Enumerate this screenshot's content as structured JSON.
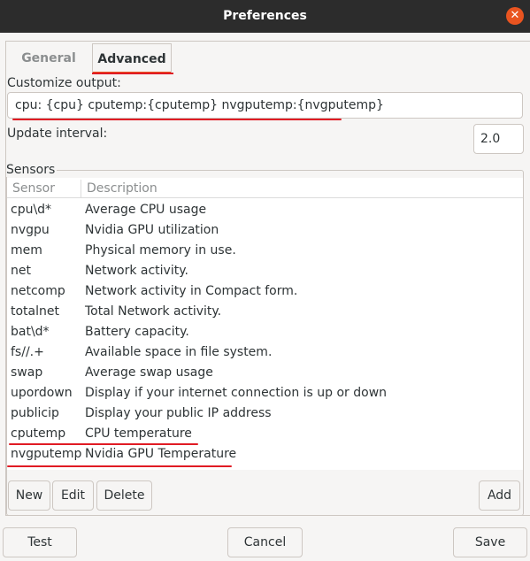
{
  "window": {
    "title": "Preferences",
    "close_icon": "close-icon"
  },
  "tabs": [
    {
      "label": "General"
    },
    {
      "label": "Advanced"
    }
  ],
  "customize": {
    "label": "Customize output:",
    "value": "cpu: {cpu} cputemp:{cputemp} nvgputemp:{nvgputemp}"
  },
  "update": {
    "label": "Update interval:",
    "value": "2.0"
  },
  "sensors": {
    "label": "Sensors",
    "columns": {
      "sensor": "Sensor",
      "description": "Description"
    },
    "rows": [
      {
        "sensor": "cpu\\d*",
        "description": "Average CPU usage"
      },
      {
        "sensor": "nvgpu",
        "description": "Nvidia GPU utilization"
      },
      {
        "sensor": "mem",
        "description": "Physical memory in use."
      },
      {
        "sensor": "net",
        "description": "Network activity."
      },
      {
        "sensor": "netcomp",
        "description": "Network activity in Compact form."
      },
      {
        "sensor": "totalnet",
        "description": "Total Network activity."
      },
      {
        "sensor": "bat\\d*",
        "description": "Battery capacity."
      },
      {
        "sensor": "fs//.+",
        "description": "Available space in file system."
      },
      {
        "sensor": "swap",
        "description": "Average swap usage"
      },
      {
        "sensor": "upordown",
        "description": "Display if your internet connection is up or down"
      },
      {
        "sensor": "publicip",
        "description": "Display your public IP address"
      },
      {
        "sensor": "cputemp",
        "description": "CPU temperature"
      },
      {
        "sensor": "nvgputemp",
        "description": "Nvidia GPU Temperature"
      }
    ],
    "buttons": {
      "new": "New",
      "edit": "Edit",
      "delete": "Delete",
      "add": "Add"
    }
  },
  "footer": {
    "test": "Test",
    "cancel": "Cancel",
    "save": "Save"
  },
  "colors": {
    "accent": "#e95420",
    "annotation": "#e01b24",
    "titlebar": "#2c2c2c"
  }
}
